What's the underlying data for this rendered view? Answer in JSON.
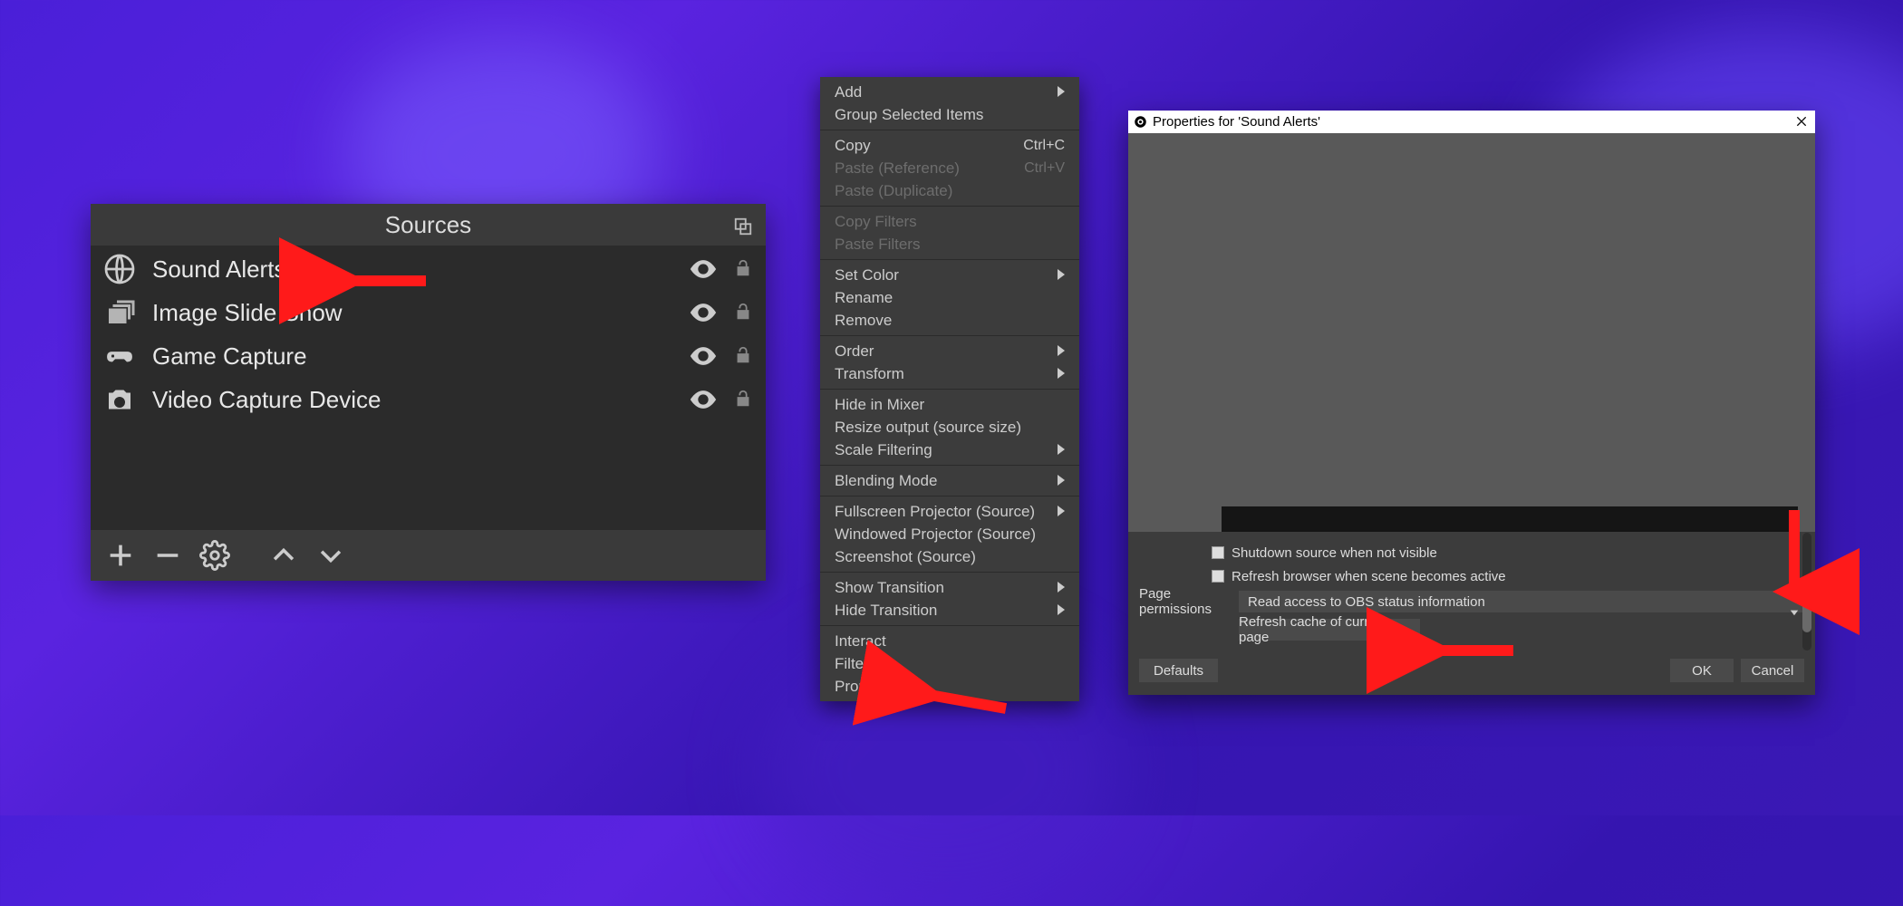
{
  "sources_panel": {
    "title": "Sources",
    "items": [
      {
        "icon": "globe-icon",
        "label": "Sound Alerts"
      },
      {
        "icon": "stack-icon",
        "label": "Image Slide Show"
      },
      {
        "icon": "gamepad-icon",
        "label": "Game Capture"
      },
      {
        "icon": "camera-icon",
        "label": "Video Capture Device"
      }
    ]
  },
  "context_menu": {
    "groups": [
      [
        {
          "label": "Add",
          "submenu": true,
          "disabled": false
        },
        {
          "label": "Group Selected Items",
          "submenu": false,
          "disabled": false
        }
      ],
      [
        {
          "label": "Copy",
          "shortcut": "Ctrl+C",
          "disabled": false
        },
        {
          "label": "Paste (Reference)",
          "shortcut": "Ctrl+V",
          "disabled": true
        },
        {
          "label": "Paste (Duplicate)",
          "disabled": true
        }
      ],
      [
        {
          "label": "Copy Filters",
          "disabled": true
        },
        {
          "label": "Paste Filters",
          "disabled": true
        }
      ],
      [
        {
          "label": "Set Color",
          "submenu": true
        },
        {
          "label": "Rename"
        },
        {
          "label": "Remove"
        }
      ],
      [
        {
          "label": "Order",
          "submenu": true
        },
        {
          "label": "Transform",
          "submenu": true
        }
      ],
      [
        {
          "label": "Hide in Mixer"
        },
        {
          "label": "Resize output (source size)"
        },
        {
          "label": "Scale Filtering",
          "submenu": true
        }
      ],
      [
        {
          "label": "Blending Mode",
          "submenu": true
        }
      ],
      [
        {
          "label": "Fullscreen Projector (Source)",
          "submenu": true
        },
        {
          "label": "Windowed Projector (Source)"
        },
        {
          "label": "Screenshot (Source)"
        }
      ],
      [
        {
          "label": "Show Transition",
          "submenu": true
        },
        {
          "label": "Hide Transition",
          "submenu": true
        }
      ],
      [
        {
          "label": "Interact"
        },
        {
          "label": "Filters"
        },
        {
          "label": "Properties"
        }
      ]
    ]
  },
  "properties_dialog": {
    "title": "Properties for 'Sound Alerts'",
    "checkbox_shutdown": "Shutdown source when not visible",
    "checkbox_refresh": "Refresh browser when scene becomes active",
    "page_permissions_label": "Page permissions",
    "page_permissions_value": "Read access to OBS status information",
    "refresh_button": "Refresh cache of current page",
    "defaults_button": "Defaults",
    "ok_button": "OK",
    "cancel_button": "Cancel"
  }
}
